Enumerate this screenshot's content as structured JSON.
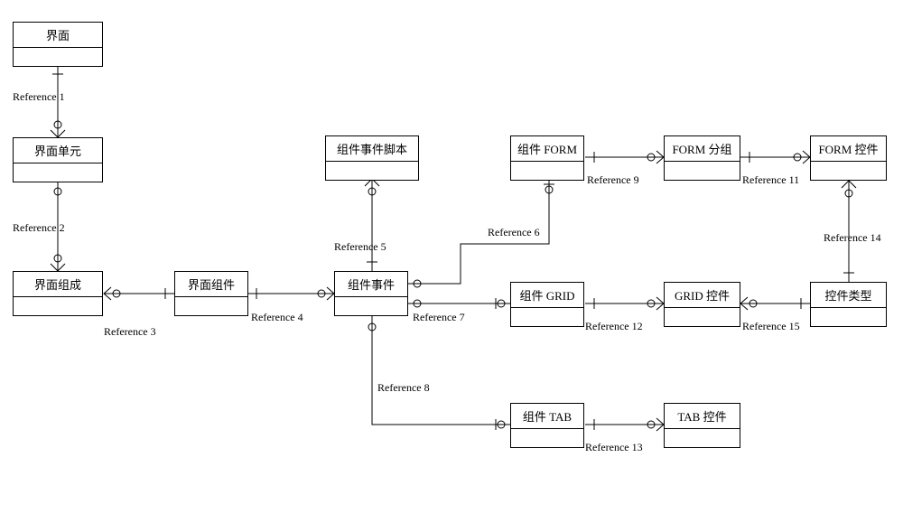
{
  "chart_data": {
    "type": "diagram",
    "diagram_kind": "entity-relationship",
    "entities": [
      {
        "id": "e1",
        "label": "界面"
      },
      {
        "id": "e2",
        "label": "界面单元"
      },
      {
        "id": "e3",
        "label": "界面组成"
      },
      {
        "id": "e4",
        "label": "界面组件"
      },
      {
        "id": "e5",
        "label": "组件事件脚本"
      },
      {
        "id": "e6",
        "label": "组件事件"
      },
      {
        "id": "e7",
        "label": "组件 FORM"
      },
      {
        "id": "e8",
        "label": "FORM 分组"
      },
      {
        "id": "e9",
        "label": "FORM 控件"
      },
      {
        "id": "e10",
        "label": "组件 GRID"
      },
      {
        "id": "e11",
        "label": "GRID 控件"
      },
      {
        "id": "e12",
        "label": "控件类型"
      },
      {
        "id": "e13",
        "label": "组件 TAB"
      },
      {
        "id": "e14",
        "label": "TAB 控件"
      }
    ],
    "relationships": [
      {
        "label": "Reference 1",
        "from": "e1",
        "to": "e2",
        "from_card": "one-mandatory",
        "to_card": "many-optional"
      },
      {
        "label": "Reference 2",
        "from": "e2",
        "to": "e3",
        "from_card": "one-optional",
        "to_card": "many-optional"
      },
      {
        "label": "Reference 3",
        "from": "e3",
        "to": "e4",
        "from_card": "one-mandatory",
        "to_card": "many-optional"
      },
      {
        "label": "Reference 4",
        "from": "e4",
        "to": "e6",
        "from_card": "one-mandatory",
        "to_card": "many-optional"
      },
      {
        "label": "Reference 5",
        "from": "e6",
        "to": "e5",
        "from_card": "one-mandatory",
        "to_card": "many-optional"
      },
      {
        "label": "Reference 6",
        "from": "e6",
        "to": "e7",
        "from_card": "one-optional",
        "to_card": "one-optional"
      },
      {
        "label": "Reference 7",
        "from": "e6",
        "to": "e10",
        "from_card": "one-optional",
        "to_card": "one-optional"
      },
      {
        "label": "Reference 8",
        "from": "e6",
        "to": "e13",
        "from_card": "one-optional",
        "to_card": "one-optional"
      },
      {
        "label": "Reference 9",
        "from": "e7",
        "to": "e8",
        "from_card": "one-mandatory",
        "to_card": "many-optional"
      },
      {
        "label": "Reference 11",
        "from": "e8",
        "to": "e9",
        "from_card": "one-mandatory",
        "to_card": "many-optional"
      },
      {
        "label": "Reference 12",
        "from": "e10",
        "to": "e11",
        "from_card": "one-mandatory",
        "to_card": "many-optional"
      },
      {
        "label": "Reference 13",
        "from": "e13",
        "to": "e14",
        "from_card": "one-mandatory",
        "to_card": "many-optional"
      },
      {
        "label": "Reference 14",
        "from": "e12",
        "to": "e9",
        "from_card": "one-mandatory",
        "to_card": "many-optional"
      },
      {
        "label": "Reference 15",
        "from": "e12",
        "to": "e11",
        "from_card": "one-mandatory",
        "to_card": "many-optional"
      }
    ]
  },
  "refs": {
    "r1": "Reference 1",
    "r2": "Reference 2",
    "r3": "Reference 3",
    "r4": "Reference 4",
    "r5": "Reference 5",
    "r6": "Reference 6",
    "r7": "Reference 7",
    "r8": "Reference 8",
    "r9": "Reference 9",
    "r11": "Reference 11",
    "r12": "Reference 12",
    "r13": "Reference 13",
    "r14": "Reference 14",
    "r15": "Reference 15"
  }
}
